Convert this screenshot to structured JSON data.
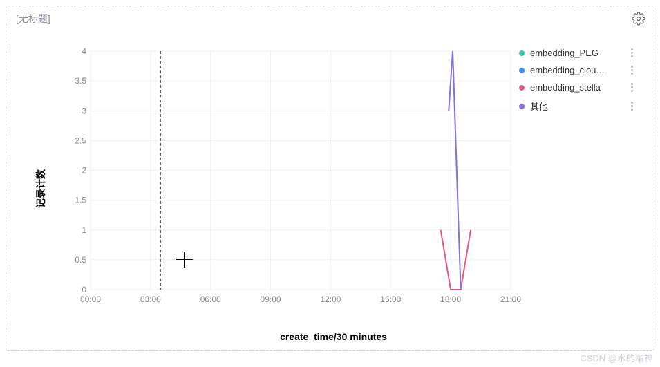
{
  "panel": {
    "title": "[无标题]"
  },
  "watermark": "CSDN @水的精神",
  "chart_data": {
    "type": "line",
    "title": "",
    "xlabel": "create_time/30 minutes",
    "ylabel": "记录计数",
    "x_tick_labels": [
      "00:00",
      "03:00",
      "06:00",
      "09:00",
      "12:00",
      "15:00",
      "18:00",
      "21:00"
    ],
    "x_tick_hours": [
      0,
      3,
      6,
      9,
      12,
      15,
      18,
      21
    ],
    "xlim_hours": [
      0,
      21
    ],
    "ylim": [
      0,
      4
    ],
    "y_ticks": [
      0,
      0.5,
      1,
      1.5,
      2,
      2.5,
      3,
      3.5,
      4
    ],
    "crosshair_at_hour": 3.5,
    "cursor_at": {
      "hour": 4.7,
      "y": 0.5
    },
    "series": [
      {
        "name": "embedding_PEG",
        "color": "#2fc6a0",
        "points": []
      },
      {
        "name": "embedding_clou…",
        "color": "#3b8ff3",
        "points": []
      },
      {
        "name": "embedding_stella",
        "color": "#e5577b",
        "points": [
          {
            "hour": 17.5,
            "y": 1
          },
          {
            "hour": 18.0,
            "y": 0
          },
          {
            "hour": 18.5,
            "y": 0
          },
          {
            "hour": 19.0,
            "y": 1
          }
        ]
      },
      {
        "name": "其他",
        "color": "#8a6fdc",
        "points": [
          {
            "hour": 17.9,
            "y": 3
          },
          {
            "hour": 18.1,
            "y": 4
          },
          {
            "hour": 18.5,
            "y": 0
          }
        ]
      }
    ]
  },
  "legend": {
    "items": [
      {
        "label": "embedding_PEG",
        "color": "#2fc6a0"
      },
      {
        "label": "embedding_clou…",
        "color": "#3b8ff3"
      },
      {
        "label": "embedding_stella",
        "color": "#e5577b"
      },
      {
        "label": "其他",
        "color": "#8a6fdc"
      }
    ]
  }
}
